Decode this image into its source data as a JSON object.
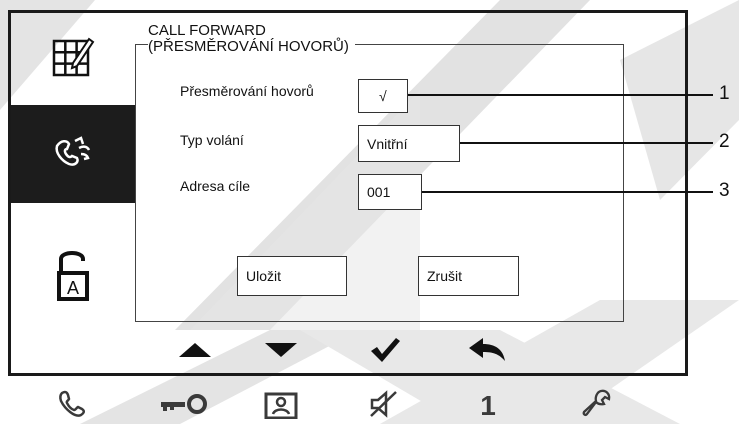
{
  "screen": {
    "title_line1": "CALL FORWARD",
    "title_line2": "(PŘESMĚROVÁNÍ HOVORŮ)"
  },
  "sidebar": {
    "items": [
      {
        "icon": "grid-edit-icon"
      },
      {
        "icon": "call-forward-icon",
        "active": true
      },
      {
        "icon": "padlock-a-icon"
      }
    ]
  },
  "form": {
    "forward_label": "Přesměrování hovorů",
    "forward_value": "√",
    "call_type_label": "Typ volání",
    "call_type_value": "Vnitřní",
    "target_label": "Adresa cíle",
    "target_value": "001",
    "save_label": "Uložit",
    "cancel_label": "Zrušit"
  },
  "callouts": [
    "1",
    "2",
    "3"
  ],
  "nav": [
    {
      "icon": "arrow-up-icon"
    },
    {
      "icon": "arrow-down-icon"
    },
    {
      "icon": "checkmark-icon"
    },
    {
      "icon": "back-arrow-icon"
    }
  ],
  "hardware_buttons": {
    "icons": [
      "phone-icon",
      "key-icon",
      "camera-icon",
      "mute-icon",
      "number-icon",
      "wrench-icon"
    ],
    "number_label": "1"
  },
  "colors": {
    "frame": "#1a1a1a",
    "active_sidebar": "#1c1c1c",
    "watermark": "#dedede"
  }
}
